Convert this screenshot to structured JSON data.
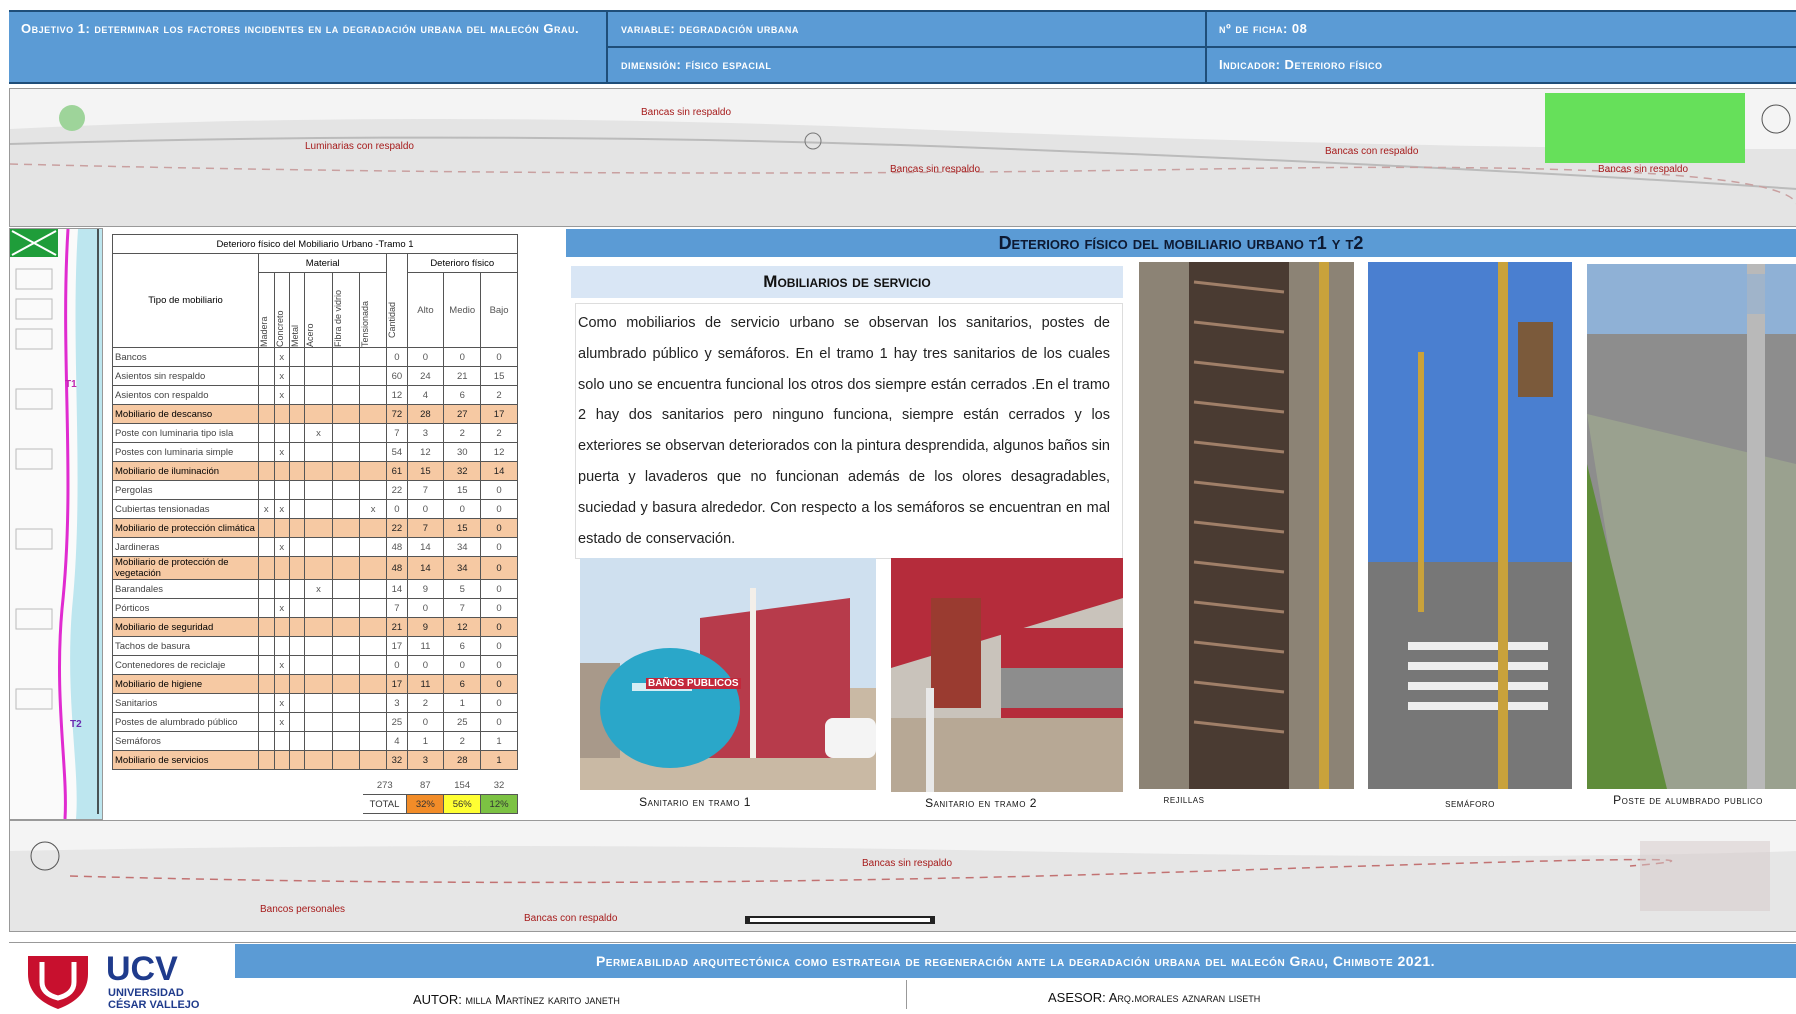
{
  "header": {
    "objective": "Objetivo 1: determinar los factores incidentes en la degradación urbana del malecón Grau.",
    "variable": "variable: degradación urbana",
    "ficha": "nº de ficha: 08",
    "dimension": "dimensión: físico espacial",
    "indicador": "Indicador: Deterioro físico"
  },
  "map_top_labels": [
    "Bancas sin respaldo",
    "Luminarias con respaldo",
    "Bancas sin respaldo",
    "Bancas con respaldo",
    "Bancas sin respaldo"
  ],
  "map_bottom_labels": [
    "Bancas sin respaldo",
    "Bancos personales",
    "Bancas con respaldo"
  ],
  "strip_labels": [
    "T1",
    "T2"
  ],
  "table": {
    "title": "Deterioro físico del Mobiliario Urbano -Tramo 1",
    "col_tipo": "Tipo de mobiliario",
    "col_material": "Material",
    "col_deterioro": "Deterioro físico",
    "materials": [
      "Madera",
      "Concreto",
      "Metal",
      "Acero",
      "Fibra de vidrio",
      "Tensionada"
    ],
    "col_cantidad": "Cantidad",
    "levels": [
      "Alto",
      "Medio",
      "Bajo"
    ],
    "rows": [
      {
        "name": "Bancos",
        "m": [
          "",
          "x",
          "",
          "",
          "",
          ""
        ],
        "cant": "0",
        "alto": "0",
        "medio": "0",
        "bajo": "0",
        "sub": false
      },
      {
        "name": "Asientos sin respaldo",
        "m": [
          "",
          "x",
          "",
          "",
          "",
          ""
        ],
        "cant": "60",
        "alto": "24",
        "medio": "21",
        "bajo": "15",
        "sub": false
      },
      {
        "name": "Asientos con respaldo",
        "m": [
          "",
          "x",
          "",
          "",
          "",
          ""
        ],
        "cant": "12",
        "alto": "4",
        "medio": "6",
        "bajo": "2",
        "sub": false
      },
      {
        "name": "Mobiliario de descanso",
        "m": [
          "",
          "",
          "",
          "",
          "",
          ""
        ],
        "cant": "72",
        "alto": "28",
        "medio": "27",
        "bajo": "17",
        "sub": true
      },
      {
        "name": "Poste con luminaria tipo isla",
        "m": [
          "",
          "",
          "",
          "x",
          "",
          ""
        ],
        "cant": "7",
        "alto": "3",
        "medio": "2",
        "bajo": "2",
        "sub": false
      },
      {
        "name": "Postes con luminaria simple",
        "m": [
          "",
          "x",
          "",
          "",
          "",
          ""
        ],
        "cant": "54",
        "alto": "12",
        "medio": "30",
        "bajo": "12",
        "sub": false
      },
      {
        "name": "Mobiliario de iluminación",
        "m": [
          "",
          "",
          "",
          "",
          "",
          ""
        ],
        "cant": "61",
        "alto": "15",
        "medio": "32",
        "bajo": "14",
        "sub": true
      },
      {
        "name": "Pergolas",
        "m": [
          "",
          "",
          "",
          "",
          "",
          ""
        ],
        "cant": "22",
        "alto": "7",
        "medio": "15",
        "bajo": "0",
        "sub": false
      },
      {
        "name": "Cubiertas tensionadas",
        "m": [
          "x",
          "x",
          "",
          "",
          "",
          "x"
        ],
        "cant": "0",
        "alto": "0",
        "medio": "0",
        "bajo": "0",
        "sub": false
      },
      {
        "name": "Mobiliario de protección climática",
        "m": [
          "",
          "",
          "",
          "",
          "",
          ""
        ],
        "cant": "22",
        "alto": "7",
        "medio": "15",
        "bajo": "0",
        "sub": true
      },
      {
        "name": "Jardineras",
        "m": [
          "",
          "x",
          "",
          "",
          "",
          ""
        ],
        "cant": "48",
        "alto": "14",
        "medio": "34",
        "bajo": "0",
        "sub": false
      },
      {
        "name": "Mobiliario de protección de vegetación",
        "m": [
          "",
          "",
          "",
          "",
          "",
          ""
        ],
        "cant": "48",
        "alto": "14",
        "medio": "34",
        "bajo": "0",
        "sub": true
      },
      {
        "name": "Barandales",
        "m": [
          "",
          "",
          "",
          "x",
          "",
          ""
        ],
        "cant": "14",
        "alto": "9",
        "medio": "5",
        "bajo": "0",
        "sub": false
      },
      {
        "name": "Pórticos",
        "m": [
          "",
          "x",
          "",
          "",
          "",
          ""
        ],
        "cant": "7",
        "alto": "0",
        "medio": "7",
        "bajo": "0",
        "sub": false
      },
      {
        "name": "Mobiliario de seguridad",
        "m": [
          "",
          "",
          "",
          "",
          "",
          ""
        ],
        "cant": "21",
        "alto": "9",
        "medio": "12",
        "bajo": "0",
        "sub": true
      },
      {
        "name": "Tachos de basura",
        "m": [
          "",
          "",
          "",
          "",
          "",
          ""
        ],
        "cant": "17",
        "alto": "11",
        "medio": "6",
        "bajo": "0",
        "sub": false
      },
      {
        "name": "Contenedores de reciclaje",
        "m": [
          "",
          "x",
          "",
          "",
          "",
          ""
        ],
        "cant": "0",
        "alto": "0",
        "medio": "0",
        "bajo": "0",
        "sub": false
      },
      {
        "name": "Mobiliario de higiene",
        "m": [
          "",
          "",
          "",
          "",
          "",
          ""
        ],
        "cant": "17",
        "alto": "11",
        "medio": "6",
        "bajo": "0",
        "sub": true
      },
      {
        "name": "Sanitarios",
        "m": [
          "",
          "x",
          "",
          "",
          "",
          ""
        ],
        "cant": "3",
        "alto": "2",
        "medio": "1",
        "bajo": "0",
        "sub": false
      },
      {
        "name": "Postes de alumbrado público",
        "m": [
          "",
          "x",
          "",
          "",
          "",
          ""
        ],
        "cant": "25",
        "alto": "0",
        "medio": "25",
        "bajo": "0",
        "sub": false
      },
      {
        "name": "Semáforos",
        "m": [
          "",
          "",
          "",
          "",
          "",
          ""
        ],
        "cant": "4",
        "alto": "1",
        "medio": "2",
        "bajo": "1",
        "sub": false
      },
      {
        "name": "Mobiliario de servicios",
        "m": [
          "",
          "",
          "",
          "",
          "",
          ""
        ],
        "cant": "32",
        "alto": "3",
        "medio": "28",
        "bajo": "1",
        "sub": true
      }
    ],
    "totals": {
      "cant": "273",
      "alto": "87",
      "medio": "154",
      "bajo": "32"
    },
    "total_label": "TOTAL",
    "pct": {
      "alto": "32%",
      "medio": "56%",
      "bajo": "12%"
    },
    "pct_colors": {
      "alto": "#f28c28",
      "medio": "#ffff33",
      "bajo": "#7cc243"
    }
  },
  "section_title": "Deterioro físico del mobiliario urbano t1 y t2",
  "subsection_title": "Mobiliarios de servicio",
  "paragraph": "Como mobiliarios de servicio urbano se observan los sanitarios, postes de alumbrado público y semáforos. En el tramo 1 hay tres sanitarios de los cuales solo uno se encuentra funcional los otros dos siempre están cerrados .En el tramo 2 hay dos sanitarios pero ninguno funciona, siempre están cerrados y los exteriores se observan deteriorados con la pintura desprendida, algunos baños sin puerta y lavaderos que no funcionan además de los olores desagradables, suciedad y basura alrededor. Con respecto a los semáforos se encuentran en mal estado de conservación.",
  "photos": {
    "sanitario1_caption": "Sanitario en tramo 1",
    "sanitario1_sign": "BAÑOS PUBLICOS",
    "sanitario2_caption": "Sanitario en tramo 2",
    "rejillas_caption": "rejillas",
    "semaforo_caption": "semáforo",
    "poste_caption": "Poste de alumbrado publico"
  },
  "footer": {
    "logo_ucv": "UCV",
    "logo_uni": "UNIVERSIDAD",
    "logo_name": "CÉSAR VALLEJO",
    "title": "Permeabilidad arquitectónica como estrategia de regeneración ante la degradación urbana del malecón Grau, Chimbote 2021.",
    "autor": "AUTOR: milla Martínez karito janeth",
    "asesor": "ASESOR: Arq.morales aznaran liseth"
  }
}
